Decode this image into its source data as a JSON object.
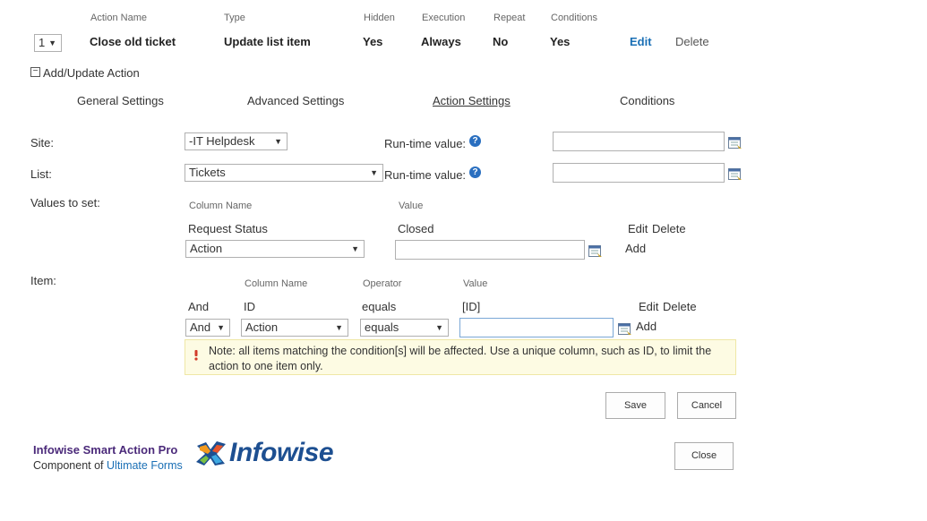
{
  "action_row": {
    "headers": {
      "name": "Action Name",
      "type": "Type",
      "hidden": "Hidden",
      "execution": "Execution",
      "repeat": "Repeat",
      "conditions": "Conditions"
    },
    "order": "1",
    "name": "Close old ticket",
    "type": "Update list item",
    "hidden": "Yes",
    "execution": "Always",
    "repeat": "No",
    "conditions": "Yes",
    "edit_label": "Edit",
    "delete_label": "Delete"
  },
  "section": {
    "toggle": "−",
    "title": "Add/Update Action"
  },
  "tabs": [
    {
      "label": "General Settings"
    },
    {
      "label": "Advanced Settings"
    },
    {
      "label": "Action Settings"
    },
    {
      "label": "Conditions"
    }
  ],
  "site": {
    "label": "Site:",
    "value": "-IT Helpdesk",
    "runtime_label": "Run-time value:",
    "runtime_value": ""
  },
  "list": {
    "label": "List:",
    "value": "Tickets",
    "runtime_label": "Run-time value:",
    "runtime_value": ""
  },
  "values_to_set": {
    "label": "Values to set:",
    "col_header": "Column Name",
    "val_header": "Value",
    "row": {
      "column": "Request Status",
      "value": "Closed",
      "edit": "Edit",
      "delete": "Delete"
    },
    "new": {
      "column_select": "Action",
      "value": "",
      "add": "Add"
    }
  },
  "item": {
    "label": "Item:",
    "col_header": "Column Name",
    "op_header": "Operator",
    "val_header": "Value",
    "row": {
      "join": "And",
      "column": "ID",
      "operator": "equals",
      "value": "[ID]",
      "edit": "Edit",
      "delete": "Delete"
    },
    "new": {
      "join_select": "And",
      "column_select": "Action",
      "operator_select": "equals",
      "value": "",
      "add": "Add"
    }
  },
  "note": "Note: all items matching the condition[s] will be affected. Use a unique column, such as ID, to limit the action to one item only.",
  "buttons": {
    "save": "Save",
    "cancel": "Cancel",
    "close": "Close"
  },
  "footer": {
    "product": "Infowise Smart Action Pro",
    "component_prefix": "Component of",
    "component_link": "Ultimate Forms",
    "logo_text": "Infowise"
  },
  "colors": {
    "link": "#1a6fb5",
    "help_icon": "#2a6fc0",
    "product": "#4b2a7a",
    "logo_blue": "#1d4f91",
    "note_bg": "#fdfbe3"
  }
}
